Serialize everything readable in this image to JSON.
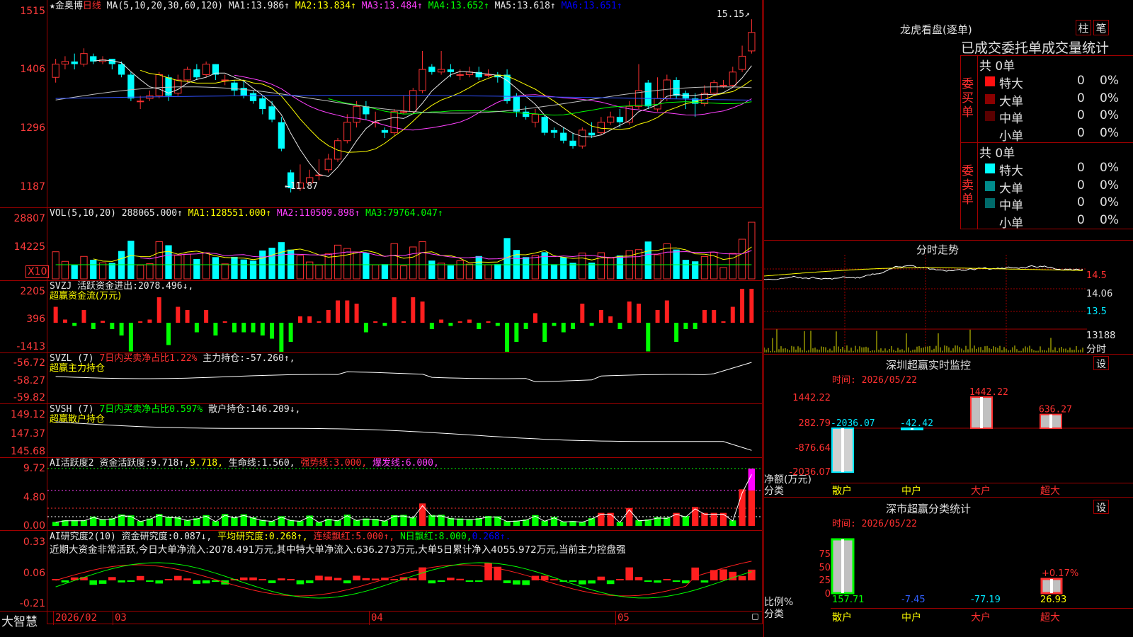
{
  "stock": {
    "name": "★金奥博",
    "period": "日线"
  },
  "main": {
    "yaxis": [
      "1515",
      "1406",
      "1296",
      "1187"
    ],
    "ma_params": "MA(5,10,20,30,60,120)",
    "ma": [
      {
        "k": "MA1:",
        "v": "13.986↑"
      },
      {
        "k": "MA2:",
        "v": "13.834↑"
      },
      {
        "k": "MA3:",
        "v": "13.484↑"
      },
      {
        "k": "MA4:",
        "v": "13.652↑"
      },
      {
        "k": "MA5:",
        "v": "13.618↑"
      },
      {
        "k": "MA6:",
        "v": "13.651↑"
      }
    ],
    "hi": "15.15",
    "lo": "11.87",
    "candles": [
      [
        14.05,
        14.3,
        14.4,
        13.95
      ],
      [
        14.3,
        14.35,
        14.45,
        14.2
      ],
      [
        14.35,
        14.3,
        14.5,
        14.2
      ],
      [
        14.3,
        14.5,
        14.6,
        14.25
      ],
      [
        14.45,
        14.35,
        14.5,
        14.3
      ],
      [
        14.35,
        14.38,
        14.45,
        14.3
      ],
      [
        14.4,
        14.3,
        14.4,
        14.2
      ],
      [
        14.3,
        14.1,
        14.35,
        14.05
      ],
      [
        14.1,
        13.65,
        14.15,
        13.6
      ],
      [
        13.6,
        13.6,
        13.7,
        13.45
      ],
      [
        13.65,
        13.7,
        13.8,
        13.6
      ],
      [
        13.7,
        14.1,
        14.15,
        13.65
      ],
      [
        14.05,
        13.7,
        14.1,
        13.6
      ],
      [
        13.75,
        14.0,
        14.1,
        13.7
      ],
      [
        14.0,
        14.2,
        14.25,
        13.95
      ],
      [
        14.2,
        14.05,
        14.3,
        14.0
      ],
      [
        14.1,
        14.3,
        14.35,
        14.05
      ],
      [
        14.3,
        14.1,
        14.3,
        14.0
      ],
      [
        14.0,
        14.0,
        14.1,
        13.9
      ],
      [
        13.95,
        13.8,
        14.0,
        13.7
      ],
      [
        13.85,
        13.7,
        14.0,
        13.65
      ],
      [
        13.75,
        13.6,
        13.8,
        13.55
      ],
      [
        13.65,
        13.45,
        13.7,
        13.35
      ],
      [
        13.5,
        13.25,
        13.6,
        13.2
      ],
      [
        13.2,
        12.7,
        13.3,
        12.65
      ],
      [
        12.25,
        11.95,
        12.3,
        11.87
      ],
      [
        11.95,
        12.05,
        12.4,
        11.9
      ],
      [
        12.05,
        12.15,
        12.3,
        12.0
      ],
      [
        12.2,
        12.2,
        12.5,
        12.1
      ],
      [
        12.3,
        12.5,
        12.6,
        12.25
      ],
      [
        12.5,
        12.85,
        12.9,
        12.45
      ],
      [
        12.85,
        13.2,
        13.35,
        12.8
      ],
      [
        13.2,
        13.5,
        13.6,
        13.1
      ],
      [
        13.5,
        13.35,
        13.6,
        13.25
      ],
      [
        13.2,
        13.2,
        13.4,
        13.1
      ],
      [
        13.05,
        13.0,
        13.1,
        12.9
      ],
      [
        13.0,
        13.4,
        13.45,
        12.95
      ],
      [
        13.4,
        13.4,
        13.7,
        13.35
      ],
      [
        13.4,
        13.8,
        13.85,
        13.35
      ],
      [
        13.8,
        14.2,
        14.55,
        13.75
      ],
      [
        14.25,
        14.15,
        14.3,
        14.1
      ],
      [
        14.15,
        14.2,
        14.55,
        14.1
      ],
      [
        14.2,
        14.15,
        14.3,
        14.05
      ],
      [
        14.1,
        14.1,
        14.2,
        14.0
      ],
      [
        14.1,
        14.15,
        14.25,
        14.05
      ],
      [
        14.15,
        14.05,
        14.25,
        14.0
      ],
      [
        14.1,
        14.1,
        14.2,
        14.05
      ],
      [
        14.1,
        14.05,
        14.15,
        13.95
      ],
      [
        14.1,
        13.6,
        14.2,
        13.55
      ],
      [
        13.7,
        13.4,
        13.75,
        13.3
      ],
      [
        13.4,
        13.3,
        13.5,
        13.25
      ],
      [
        13.2,
        13.35,
        13.45,
        13.1
      ],
      [
        13.3,
        13.0,
        13.35,
        12.95
      ],
      [
        13.05,
        13.0,
        13.1,
        12.9
      ],
      [
        13.0,
        12.85,
        13.1,
        12.8
      ],
      [
        12.85,
        12.75,
        13.0,
        12.7
      ],
      [
        12.75,
        13.05,
        13.1,
        12.7
      ],
      [
        13.0,
        12.95,
        13.2,
        12.9
      ],
      [
        13.0,
        13.2,
        13.3,
        12.95
      ],
      [
        13.2,
        13.3,
        13.4,
        13.15
      ],
      [
        13.3,
        13.2,
        13.45,
        13.1
      ],
      [
        13.2,
        13.5,
        13.6,
        13.15
      ],
      [
        13.5,
        13.8,
        14.3,
        13.45
      ],
      [
        13.95,
        13.5,
        14.0,
        13.45
      ],
      [
        13.45,
        13.65,
        14.05,
        13.4
      ],
      [
        13.65,
        14.0,
        14.1,
        13.6
      ],
      [
        14.0,
        13.7,
        14.05,
        13.65
      ],
      [
        13.75,
        13.65,
        13.8,
        13.45
      ],
      [
        13.65,
        13.55,
        13.75,
        13.3
      ],
      [
        13.55,
        13.75,
        13.9,
        13.5
      ],
      [
        13.75,
        13.95,
        14.0,
        13.7
      ],
      [
        13.9,
        13.9,
        14.0,
        13.85
      ],
      [
        13.9,
        14.15,
        14.25,
        13.85
      ],
      [
        14.2,
        14.45,
        14.65,
        14.15
      ],
      [
        14.55,
        14.9,
        15.15,
        14.5
      ]
    ]
  },
  "vol": {
    "params": "VOL(5,10,20)",
    "val": "288065.000↑",
    "ma": [
      {
        "k": "MA1:",
        "v": "128551.000↑"
      },
      {
        "k": "MA2:",
        "v": "110509.898↑"
      },
      {
        "k": "MA3:",
        "v": "79764.047↑"
      }
    ],
    "yaxis": [
      "28807",
      "14225"
    ],
    "unit": "X10"
  },
  "svzj": {
    "name": "SVZJ",
    "desc": "活跃资金进出:",
    "val": "2078.496↓,",
    "sub": "超赢资金流(万元)",
    "yaxis": [
      "2205",
      "396",
      "-1413"
    ]
  },
  "svzl": {
    "name": "SVZL (7)",
    "desc": "7日内买卖净占比1.22%",
    "k": "主力持仓:",
    "val": "-57.260↑,",
    "sub": "超赢主力持仓",
    "yaxis": [
      "-56.72",
      "-58.27",
      "-59.82"
    ]
  },
  "svsh": {
    "name": "SVSH (7)",
    "desc": "7日内买卖净占比0.597%",
    "k": "散户持仓:",
    "val": "146.209↓,",
    "sub": "超赢散户持仓",
    "yaxis": [
      "149.12",
      "147.37",
      "145.68"
    ]
  },
  "ai2": {
    "name": "AI活跃度2",
    "k": "资金活跃度:",
    "val1": "9.718↑,",
    "val2": "9.718,",
    "k2": "生命线:",
    "v2": "1.560,",
    "k3": "强势线:",
    "v3": "3.000,",
    "k4": "爆发线:",
    "v4": "6.000,",
    "yaxis": [
      "9.72",
      "4.80",
      "0.00"
    ]
  },
  "ai_res": {
    "name": "AI研究度2(10)",
    "k": "资金研究度:",
    "v": "0.087↓,",
    "k2": "平均研究度:",
    "v2": "0.268↑,",
    "k3": "连续飘红:",
    "v3": "5.000↑,",
    "k4": "N日飘红:",
    "v4": "8.000,",
    "v5": "0.268↑.",
    "note": "近期大资金非常活跃,今日大单净流入:2078.491万元,其中特大单净流入:636.273万元,大单5日累计净入4055.972万元,当前主力控盘强",
    "yaxis": [
      "0.33",
      "0.06",
      "-0.21"
    ]
  },
  "bottom": {
    "brand": "大智慧",
    "dates": [
      "2026/02",
      "03",
      "04",
      "05"
    ]
  },
  "right": {
    "lhb": {
      "title": "龙虎看盘(逐单)",
      "btn1": "柱",
      "btn2": "笔",
      "header": "已成交委托单成交量统计",
      "buy": {
        "label": [
          "委",
          "买",
          "单"
        ],
        "total": "共 0单",
        "rows": [
          {
            "name": "特大",
            "count": "0",
            "pct": "0%",
            "color": "#ff1010"
          },
          {
            "name": "大单",
            "count": "0",
            "pct": "0%",
            "color": "#8b0000"
          },
          {
            "name": "中单",
            "count": "0",
            "pct": "0%",
            "color": "#5a0000"
          },
          {
            "name": "小单",
            "count": "0",
            "pct": "0%",
            "color": ""
          }
        ]
      },
      "sell": {
        "label": [
          "委",
          "卖",
          "单"
        ],
        "total": "共 0单",
        "rows": [
          {
            "name": "特大",
            "count": "0",
            "pct": "0%",
            "color": "#00ffff"
          },
          {
            "name": "大单",
            "count": "0",
            "pct": "0%",
            "color": "#008b8b"
          },
          {
            "name": "中单",
            "count": "0",
            "pct": "0%",
            "color": "#006a6a"
          },
          {
            "name": "小单",
            "count": "0",
            "pct": "0%",
            "color": ""
          }
        ]
      }
    },
    "fenshi": {
      "title": "分时走势",
      "yaxis": [
        "14.5",
        "14.06",
        "13.5",
        "13188"
      ],
      "unit": "分时"
    },
    "szmon": {
      "title": "深圳超赢实时监控",
      "set": "设",
      "time": "时间: 2026/05/22",
      "yaxis": [
        "1442.22",
        "282.79",
        "-876.64",
        "-2036.07"
      ],
      "ylab": "净额(万元)",
      "xlab": "分类",
      "cats": [
        "散户",
        "中户",
        "大户",
        "超大"
      ],
      "values": [
        "-2036.07",
        "-42.42",
        "1442.22",
        "636.27"
      ],
      "nums": [
        -2036.07,
        -42.42,
        1442.22,
        636.27
      ]
    },
    "szcls": {
      "title": "深市超赢分类统计",
      "set": "设",
      "time": "时间: 2026/05/22",
      "yaxis": [
        "75",
        "50",
        "25",
        "0"
      ],
      "ylab": "比例%",
      "xlab": "分类",
      "cats": [
        "散户",
        "中户",
        "大户",
        "超大"
      ],
      "values": [
        "157.71",
        "-7.45",
        "-77.19",
        "26.93"
      ],
      "note": "+0.17%"
    }
  }
}
